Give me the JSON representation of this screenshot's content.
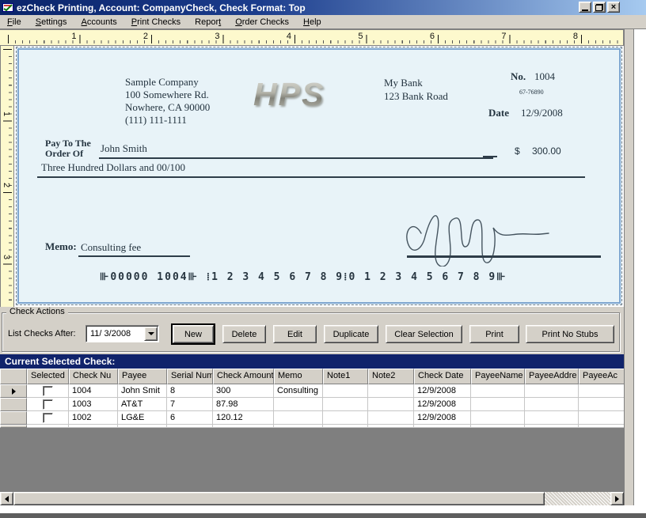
{
  "window": {
    "title": "ezCheck Printing, Account: CompanyCheck, Check Format: Top"
  },
  "menu": {
    "items": [
      {
        "label": "File",
        "accel": 0
      },
      {
        "label": "Settings",
        "accel": 0
      },
      {
        "label": "Accounts",
        "accel": 0
      },
      {
        "label": "Print Checks",
        "accel": 0
      },
      {
        "label": "Report",
        "accel": 5
      },
      {
        "label": "Order Checks",
        "accel": 0
      },
      {
        "label": "Help",
        "accel": 0
      }
    ]
  },
  "ruler": {
    "horizontal": [
      "1",
      "2",
      "3",
      "4",
      "5",
      "6",
      "7",
      "8"
    ],
    "vertical": [
      "1",
      "2",
      "3"
    ]
  },
  "check": {
    "company_name": "Sample Company",
    "company_address1": "100 Somewhere Rd.",
    "company_address2": "Nowhere, CA 90000",
    "company_phone": "(111) 111-1111",
    "logo_text": "HPS",
    "bank_name": "My Bank",
    "bank_address": "123 Bank Road",
    "no_label": "No.",
    "check_number": "1004",
    "fraction": "67-76890",
    "date_label": "Date",
    "date_value": "12/9/2008",
    "pay_to_line1": "Pay To The",
    "pay_to_line2": "Order Of",
    "payee": "John Smith",
    "dollar_sign": "$",
    "amount_numeric": "300.00",
    "amount_words": "Three Hundred  Dollars and 00/100",
    "memo_label": "Memo:",
    "memo_value": "Consulting fee",
    "micr_line": "⊪00000 1004⊪ ⁞1 2 3 4 5 6 7 8 9⁞0 1 2 3 4 5 6 7 8 9⊪"
  },
  "actions": {
    "group_label": "Check Actions",
    "list_label": "List Checks After:",
    "date_value": "11/ 3/2008",
    "buttons": [
      "New",
      "Delete",
      "Edit",
      "Duplicate",
      "Clear Selection",
      "Print",
      "Print No Stubs"
    ]
  },
  "grid": {
    "title": "Current Selected Check:",
    "columns": [
      "Selected",
      "Check Nu",
      "Payee",
      "Serial Num",
      "Check Amount",
      "Memo",
      "Note1",
      "Note2",
      "Check Date",
      "PayeeName",
      "PayeeAddre",
      "PayeeAc"
    ],
    "rows": [
      [
        "1004",
        "John Smit",
        "8",
        "300",
        "Consulting",
        "",
        "",
        "12/9/2008",
        "",
        "",
        ""
      ],
      [
        "1003",
        "AT&T",
        "7",
        "87.98",
        "",
        "",
        "",
        "12/9/2008",
        "",
        "",
        ""
      ],
      [
        "1002",
        "LG&E",
        "6",
        "120.12",
        "",
        "",
        "",
        "12/9/2008",
        "",
        "",
        ""
      ]
    ]
  },
  "colors": {
    "titlebar_left": "#0a246a",
    "titlebar_right": "#a6caf0",
    "chrome_gray": "#d4d0c8",
    "ruler_cream": "#fdf9cd",
    "check_background": "#e8f3f8",
    "grid_header_navy": "#10236b",
    "grid_filler_gray": "#7f7f7f"
  }
}
